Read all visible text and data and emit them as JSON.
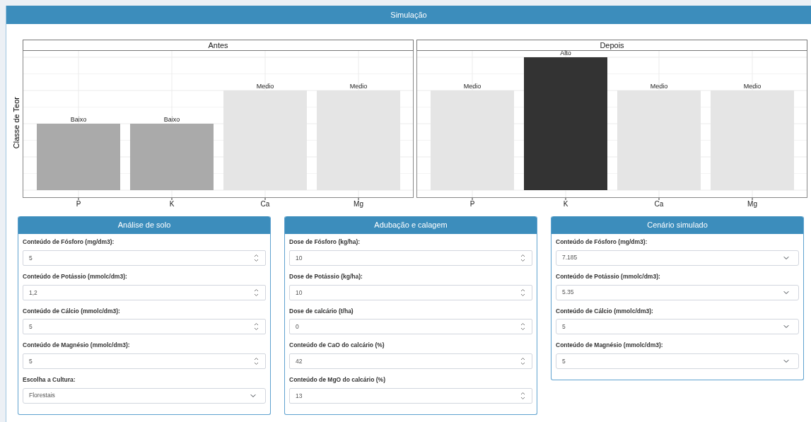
{
  "box": {
    "title": "Simulação"
  },
  "charts": [
    {
      "title": "Antes",
      "ylabel": "Classe de Teor",
      "bars": [
        {
          "category": "P",
          "class": "Baixo",
          "kind": "low"
        },
        {
          "category": "K",
          "class": "Baixo",
          "kind": "low"
        },
        {
          "category": "Ca",
          "class": "Medio",
          "kind": "medium"
        },
        {
          "category": "Mg",
          "class": "Medio",
          "kind": "medium"
        }
      ]
    },
    {
      "title": "Depois",
      "bars": [
        {
          "category": "P",
          "class": "Medio",
          "kind": "medium"
        },
        {
          "category": "K",
          "class": "Alto",
          "kind": "high"
        },
        {
          "category": "Ca",
          "class": "Medio",
          "kind": "medium"
        },
        {
          "category": "Mg",
          "class": "Medio",
          "kind": "medium"
        }
      ]
    }
  ],
  "panels": [
    {
      "title": "Análise de solo",
      "fields": [
        {
          "kind": "number",
          "label": "Conteúdo de Fósforo (mg/dm3):",
          "value": "5"
        },
        {
          "kind": "number",
          "label": "Conteúdo de Potássio (mmolc/dm3):",
          "value": "1,2"
        },
        {
          "kind": "number",
          "label": "Conteúdo de Cálcio (mmolc/dm3):",
          "value": "5"
        },
        {
          "kind": "number",
          "label": "Conteúdo de Magnésio (mmolc/dm3):",
          "value": "5"
        },
        {
          "kind": "select",
          "label": "Escolha a Cultura:",
          "value": "Florestais"
        }
      ]
    },
    {
      "title": "Adubação e calagem",
      "fields": [
        {
          "kind": "number",
          "label": "Dose de Fósforo (kg/ha):",
          "value": "10"
        },
        {
          "kind": "number",
          "label": "Dose de Potássio (kg/ha):",
          "value": "10"
        },
        {
          "kind": "number",
          "label": "Dose de calcário (t/ha)",
          "value": "0"
        },
        {
          "kind": "number",
          "label": "Conteúdo de CaO do calcário (%)",
          "value": "42"
        },
        {
          "kind": "number",
          "label": "Conteúdo de MgO do calcário (%)",
          "value": "13"
        }
      ]
    },
    {
      "title": "Cenário simulado",
      "fields": [
        {
          "kind": "select",
          "label": "Conteúdo de Fósforo (mg/dm3):",
          "value": "7.185"
        },
        {
          "kind": "select",
          "label": "Conteúdo de Potássio (mmolc/dm3):",
          "value": "5.35"
        },
        {
          "kind": "select",
          "label": "Conteúdo de Cálcio (mmolc/dm3):",
          "value": "5"
        },
        {
          "kind": "select",
          "label": "Conteúdo de Magnésio (mmolc/dm3):",
          "value": "5"
        }
      ]
    }
  ]
}
